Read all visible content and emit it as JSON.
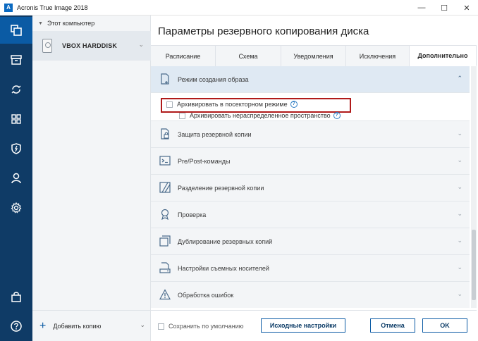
{
  "window": {
    "logo_letter": "A",
    "title": "Acronis True Image 2018",
    "minimize": "—",
    "maximize": "☐",
    "close": "✕"
  },
  "sidebar_sources": {
    "header": "Этот компьютер",
    "disk": "VBOX HARDDISK",
    "add_backup": "Добавить копию"
  },
  "main": {
    "title": "Параметры резервного копирования диска",
    "tabs": [
      {
        "label": "Расписание"
      },
      {
        "label": "Схема"
      },
      {
        "label": "Уведомления"
      },
      {
        "label": "Исключения"
      },
      {
        "label": "Дополнительно"
      }
    ],
    "sections": [
      {
        "label": "Режим создания образа",
        "icon": "image-mode-icon"
      },
      {
        "label": "Защита резервной копии",
        "icon": "lock-icon"
      },
      {
        "label": "Pre/Post-команды",
        "icon": "terminal-icon"
      },
      {
        "label": "Разделение резервной копии",
        "icon": "split-icon"
      },
      {
        "label": "Проверка",
        "icon": "badge-icon"
      },
      {
        "label": "Дублирование резервных копий",
        "icon": "duplicate-icon"
      },
      {
        "label": "Настройки съемных носителей",
        "icon": "removable-media-icon"
      },
      {
        "label": "Обработка ошибок",
        "icon": "warning-icon"
      }
    ],
    "options": {
      "sector_by_sector": "Архивировать в посекторном режиме",
      "unallocated": "Архивировать нераспределенное пространство",
      "help_glyph": "?"
    },
    "footer": {
      "save_default": "Сохранить по умолчанию",
      "reset": "Исходные настройки",
      "cancel": "Отмена",
      "ok": "OK"
    }
  },
  "colors": {
    "rail": "#0f3b66",
    "rail_active": "#0b5ba4",
    "accent": "#0b5ba4",
    "highlight": "#b01a1a"
  }
}
